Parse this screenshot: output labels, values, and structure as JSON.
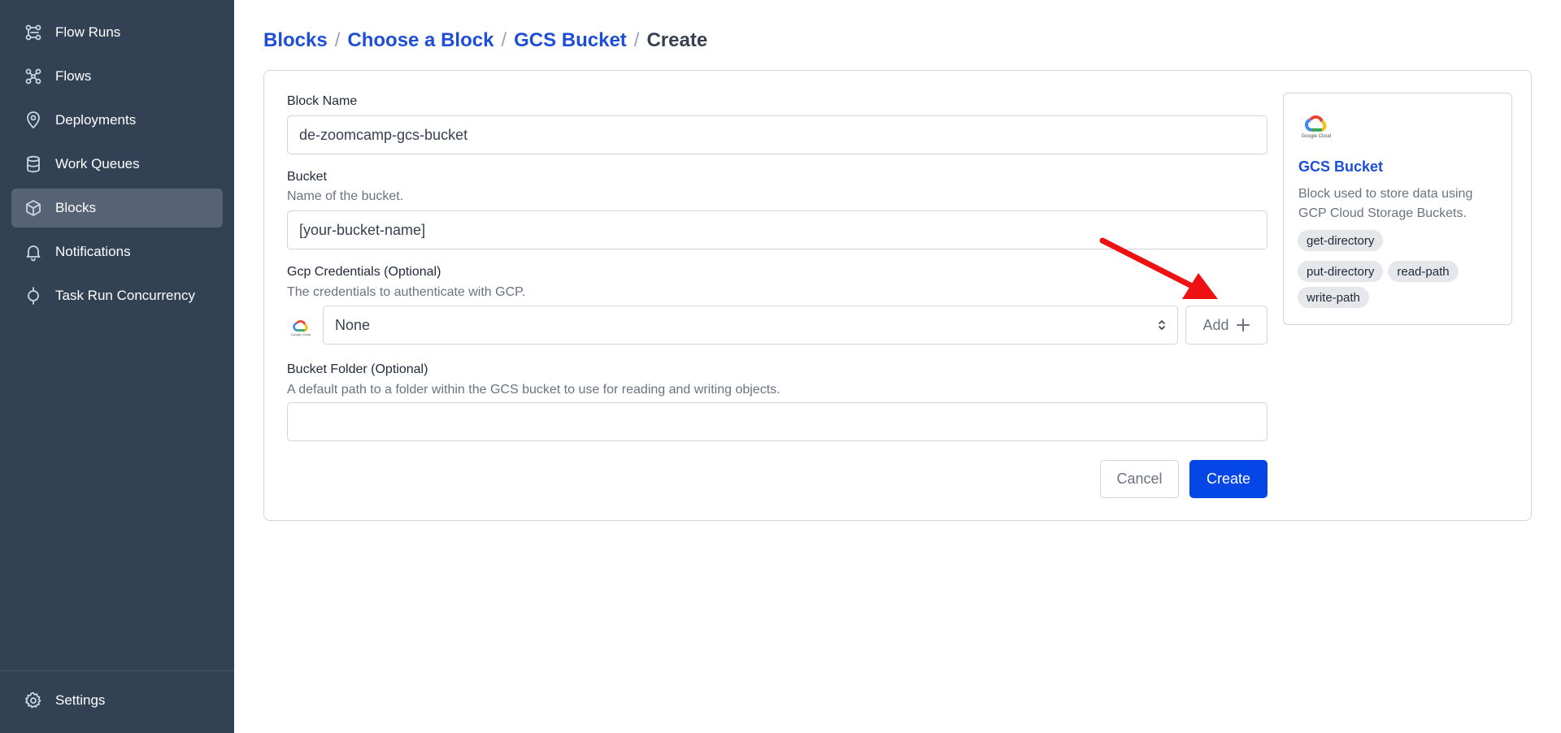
{
  "sidebar": {
    "items": [
      {
        "label": "Flow Runs",
        "icon": "flow-runs-icon"
      },
      {
        "label": "Flows",
        "icon": "flows-icon"
      },
      {
        "label": "Deployments",
        "icon": "location-pin-icon"
      },
      {
        "label": "Work Queues",
        "icon": "database-icon"
      },
      {
        "label": "Blocks",
        "icon": "cube-icon",
        "active": true
      },
      {
        "label": "Notifications",
        "icon": "bell-icon"
      },
      {
        "label": "Task Run Concurrency",
        "icon": "concurrency-icon"
      }
    ],
    "settings_label": "Settings"
  },
  "breadcrumb": {
    "items": [
      "Blocks",
      "Choose a Block",
      "GCS Bucket"
    ],
    "separator": "/",
    "current": "Create"
  },
  "form": {
    "block_name": {
      "label": "Block Name",
      "value": "de-zoomcamp-gcs-bucket"
    },
    "bucket": {
      "label": "Bucket",
      "help": "Name of the bucket.",
      "value": "[your-bucket-name]"
    },
    "gcp_credentials": {
      "label": "Gcp Credentials (Optional)",
      "help": "The credentials to authenticate with GCP.",
      "selected": "None",
      "add_label": "Add"
    },
    "bucket_folder": {
      "label": "Bucket Folder (Optional)",
      "help": "A default path to a folder within the GCS bucket to use for reading and writing objects.",
      "value": ""
    },
    "cancel_label": "Cancel",
    "create_label": "Create"
  },
  "info": {
    "logo_text": "Google Cloud",
    "title": "GCS Bucket",
    "description": "Block used to store data using GCP Cloud Storage Buckets.",
    "tags": [
      "get-directory",
      "put-directory",
      "read-path",
      "write-path"
    ]
  },
  "colors": {
    "sidebar_bg": "#334155",
    "sidebar_active": "#566374",
    "link_blue": "#1d4ed8",
    "primary_button": "#0546e6",
    "annotation_arrow": "#ee1111"
  }
}
